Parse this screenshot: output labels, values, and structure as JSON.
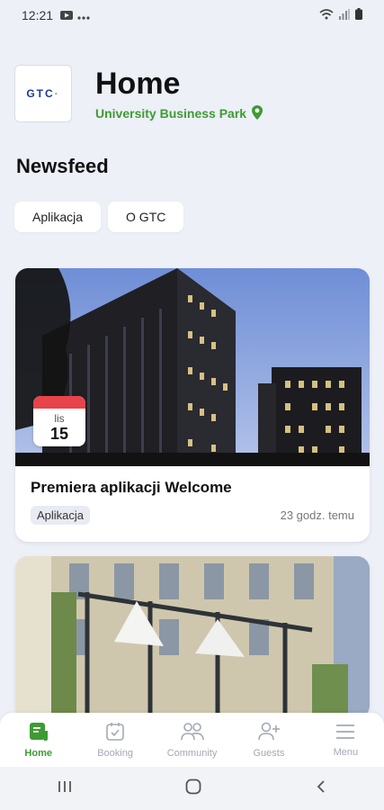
{
  "status_bar": {
    "time": "12:21"
  },
  "header": {
    "logo_text_main": "GTC",
    "logo_text_accent": "·",
    "title": "Home",
    "location": "University Business Park"
  },
  "newsfeed": {
    "section_title": "Newsfeed",
    "filters": [
      {
        "label": "Aplikacja"
      },
      {
        "label": "O GTC"
      }
    ],
    "posts": [
      {
        "title": "Premiera aplikacji Welcome",
        "tag": "Aplikacja",
        "time_ago": "23 godz. temu",
        "date_month": "lis",
        "date_day": "15"
      }
    ]
  },
  "bottom_nav": [
    {
      "label": "Home",
      "icon": "home-icon",
      "active": true
    },
    {
      "label": "Booking",
      "icon": "booking-icon",
      "active": false
    },
    {
      "label": "Community",
      "icon": "community-icon",
      "active": false
    },
    {
      "label": "Guests",
      "icon": "add-guest-icon",
      "active": false
    },
    {
      "label": "Menu",
      "icon": "menu-icon",
      "active": false
    }
  ],
  "colors": {
    "accent": "#3e9b33",
    "background": "#edf0f7",
    "date_badge": "#e8424a"
  }
}
